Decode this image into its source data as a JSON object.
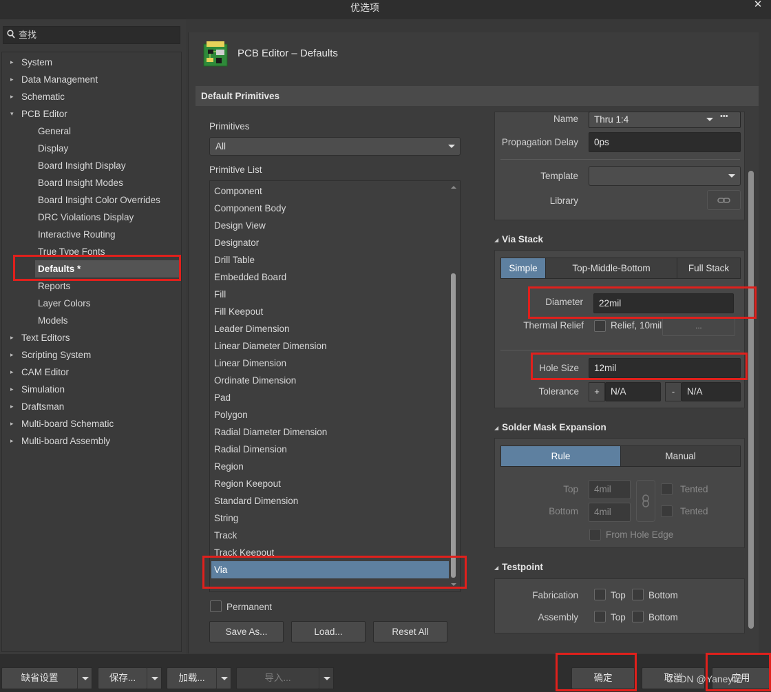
{
  "window": {
    "title": "优选项",
    "close": "✕"
  },
  "search": {
    "placeholder": "查找"
  },
  "tree": [
    {
      "label": "System",
      "arrow": "▸",
      "level": 0
    },
    {
      "label": "Data Management",
      "arrow": "▸",
      "level": 0
    },
    {
      "label": "Schematic",
      "arrow": "▸",
      "level": 0
    },
    {
      "label": "PCB Editor",
      "arrow": "▾",
      "level": 0
    },
    {
      "label": "General",
      "arrow": "",
      "level": 1
    },
    {
      "label": "Display",
      "arrow": "",
      "level": 1
    },
    {
      "label": "Board Insight Display",
      "arrow": "",
      "level": 1
    },
    {
      "label": "Board Insight Modes",
      "arrow": "",
      "level": 1
    },
    {
      "label": "Board Insight Color Overrides",
      "arrow": "",
      "level": 1
    },
    {
      "label": "DRC Violations Display",
      "arrow": "",
      "level": 1
    },
    {
      "label": "Interactive Routing",
      "arrow": "",
      "level": 1
    },
    {
      "label": "True Type Fonts",
      "arrow": "",
      "level": 1
    },
    {
      "label": "Defaults *",
      "arrow": "",
      "level": 1,
      "selected": true
    },
    {
      "label": "Reports",
      "arrow": "",
      "level": 1
    },
    {
      "label": "Layer Colors",
      "arrow": "",
      "level": 1
    },
    {
      "label": "Models",
      "arrow": "",
      "level": 1
    },
    {
      "label": "Text Editors",
      "arrow": "▸",
      "level": 0
    },
    {
      "label": "Scripting System",
      "arrow": "▸",
      "level": 0
    },
    {
      "label": "CAM Editor",
      "arrow": "▸",
      "level": 0
    },
    {
      "label": "Simulation",
      "arrow": "▸",
      "level": 0
    },
    {
      "label": "Draftsman",
      "arrow": "▸",
      "level": 0
    },
    {
      "label": "Multi-board Schematic",
      "arrow": "▸",
      "level": 0
    },
    {
      "label": "Multi-board Assembly",
      "arrow": "▸",
      "level": 0
    }
  ],
  "header": {
    "title": "PCB Editor – Defaults",
    "section": "Default Primitives"
  },
  "primitives": {
    "label": "Primitives",
    "selected": "All",
    "list_label": "Primitive List",
    "items": [
      "Component",
      "Component Body",
      "Design View",
      "Designator",
      "Drill Table",
      "Embedded Board",
      "Fill",
      "Fill Keepout",
      "Leader Dimension",
      "Linear Diameter Dimension",
      "Linear Dimension",
      "Ordinate Dimension",
      "Pad",
      "Polygon",
      "Radial Diameter Dimension",
      "Radial Dimension",
      "Region",
      "Region Keepout",
      "Standard Dimension",
      "String",
      "Track",
      "Track Keepout",
      "Via"
    ],
    "selected_item": "Via",
    "permanent": "Permanent",
    "buttons": {
      "save_as": "Save As...",
      "load": "Load...",
      "reset_all": "Reset All"
    }
  },
  "props": {
    "name_label": "Name",
    "name_value": "Thru 1:4",
    "name_more": "•••",
    "prop_delay_label": "Propagation Delay",
    "prop_delay_value": "0ps",
    "template_label": "Template",
    "template_value": "",
    "library_label": "Library",
    "via_stack": {
      "title": "Via Stack",
      "tabs": [
        "Simple",
        "Top-Middle-Bottom",
        "Full Stack"
      ],
      "diameter_label": "Diameter",
      "diameter_value": "22mil",
      "thermal_label": "Thermal Relief",
      "thermal_value": "Relief, 10mil",
      "thermal_more": "...",
      "hole_label": "Hole Size",
      "hole_value": "12mil",
      "tolerance_label": "Tolerance",
      "tol_plus": "+",
      "tol_plus_value": "N/A",
      "tol_minus": "-",
      "tol_minus_value": "N/A"
    },
    "solder_mask": {
      "title": "Solder Mask Expansion",
      "tabs": [
        "Rule",
        "Manual"
      ],
      "top_label": "Top",
      "top_value": "4mil",
      "bottom_label": "Bottom",
      "bottom_value": "4mil",
      "tented": "Tented",
      "from_hole_edge": "From Hole Edge"
    },
    "testpoint": {
      "title": "Testpoint",
      "fabrication_label": "Fabrication",
      "assembly_label": "Assembly",
      "top": "Top",
      "bottom": "Bottom"
    }
  },
  "footer": {
    "defaults": "缺省设置",
    "save": "保存...",
    "load": "加载...",
    "import": "导入...",
    "ok": "确定",
    "cancel": "取消",
    "apply": "应用",
    "watermark": "CSDN @Yaney记"
  },
  "colors": {
    "accent": "#5e80a0",
    "highlight": "#e0201c"
  }
}
